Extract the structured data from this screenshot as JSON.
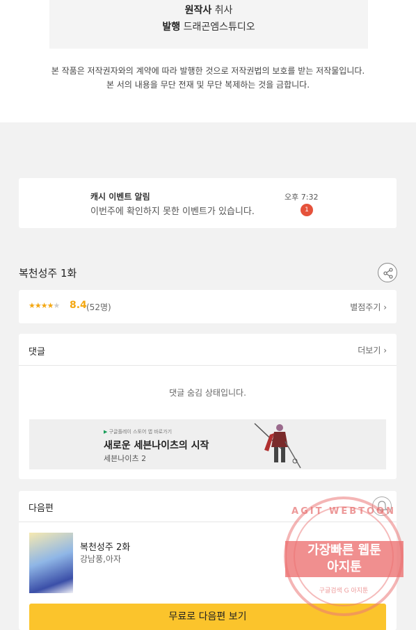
{
  "credits": {
    "original_label": "원작사",
    "original_value": "취사",
    "publisher_label": "발행",
    "publisher_value": "드래곤엠스튜디오"
  },
  "copyright": {
    "line1": "본 작품은 저작권자와의 계약에 따라 발행한 것으로 저작권법의 보호를 받는 저작물입니다.",
    "line2": "본 서의 내용을 무단 전재 및 무단 복제하는 것을 금합니다."
  },
  "notification": {
    "title": "캐시 이벤트 알림",
    "message": "이번주에 확인하지 못한 이벤트가 있습니다.",
    "time": "오후 7:32",
    "badge_count": "1"
  },
  "episode": {
    "title": "복천성주 1화",
    "share_icon": "share-icon"
  },
  "rating": {
    "stars_filled": 4,
    "stars_total": 5,
    "score": "8.4",
    "count": "(52명)",
    "rate_link": "별점주기 ›",
    "star_color": "#f3a712"
  },
  "comments": {
    "title": "댓글",
    "more_label": "더보기 ›",
    "hidden_message": "댓글 숨김 상태입니다."
  },
  "ad": {
    "store_text": "구글플레이 스토어 앱 바로가기",
    "headline": "새로운 세븐나이츠의 시작",
    "subtitle": "세븐나이츠 2"
  },
  "next_episode": {
    "section_title": "다음편",
    "episode_title": "복천성주 2화",
    "authors": "강남풍,아자",
    "button_label": "무료로 다음편 보기",
    "button_color": "#fbc42c"
  },
  "stamp": {
    "ring_text": "AGIT WEBTOON",
    "line1": "가장빠른 웹툰",
    "line2": "아지툰",
    "footer": "구글검색  G  아지툰"
  }
}
